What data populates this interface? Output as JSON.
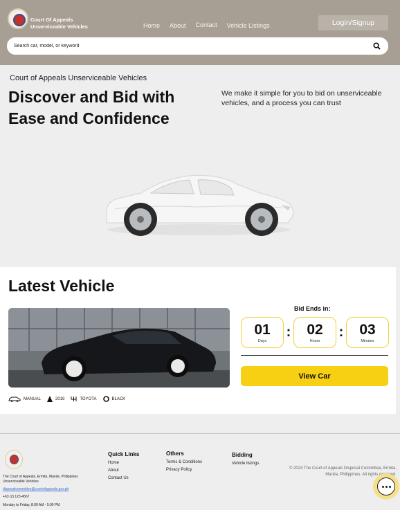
{
  "header": {
    "logo_line1": "Court Of Appeals",
    "logo_line2": "Unserviceable Vehicles",
    "nav": [
      "Home",
      "About",
      "Contact",
      "Vehicle Listings"
    ],
    "login_label": "Login/Signup",
    "search_placeholder": "Search car, model, or keyword",
    "search_icon": "search-icon"
  },
  "hero": {
    "subtitle": "Court of Appeals Unserviceable Vehicles",
    "title": "Discover and Bid with Ease and Confidence",
    "description": "We make it simple for you to bid on unserviceable vehicles, and a process you can trust"
  },
  "latest": {
    "title": "Latest Vehicle",
    "specs": [
      {
        "icon": "car-icon",
        "label": "MANUAL"
      },
      {
        "icon": "triangle-icon",
        "label": "2019"
      },
      {
        "icon": "gearshift-icon",
        "label": "TOYOTA"
      },
      {
        "icon": "circle-icon",
        "label": "BLACK"
      }
    ],
    "bid_label": "Bid Ends in:",
    "countdown": [
      {
        "value": "01",
        "unit": "Days"
      },
      {
        "value": "02",
        "unit": "Hours"
      },
      {
        "value": "03",
        "unit": "Minutes"
      }
    ],
    "separator": ":",
    "view_button": "View Car",
    "accent_color": "#f7cf13"
  },
  "footer": {
    "address": "The Court of Appeals, Ermita, Manila, Philippines Unserviceable Vehicles",
    "email": "disposalcommittee@courtofappeals.gov.ph",
    "phone": "+63 (2) 123-4567",
    "hours": "Monday to Friday, 8:00 AM - 5:00 PM",
    "quick_links": {
      "title": "Quick Links",
      "items": [
        "Home",
        "About",
        "Contact Us"
      ]
    },
    "others": {
      "title": "Others",
      "items": [
        "Terms & Conditions",
        "Privacy Policy"
      ]
    },
    "bidding": {
      "title": "Bidding",
      "items": [
        "Vehicle listings"
      ]
    },
    "copyright": "© 2024 The Court of Appeals Disposal Committee, Ermita, Manila, Philippines. All rights reserved.",
    "chat_icon": "chat-icon"
  }
}
